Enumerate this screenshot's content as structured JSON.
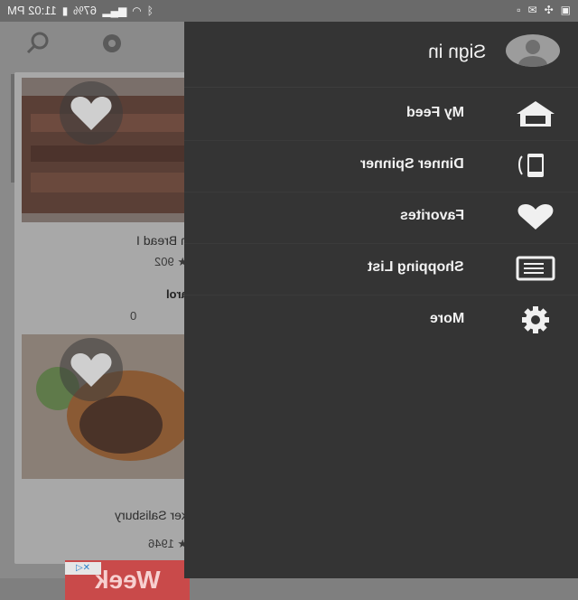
{
  "status_bar": {
    "time": "11:02 PM",
    "battery": "67%"
  },
  "drawer": {
    "sign_in": "Sign in",
    "items": [
      {
        "label": "My Feed",
        "icon": "home-icon"
      },
      {
        "label": "Dinner Spinner",
        "icon": "phone-spinner-icon"
      },
      {
        "label": "Favorites",
        "icon": "heart-icon"
      },
      {
        "label": "Shopping List",
        "icon": "list-icon"
      },
      {
        "label": "More",
        "icon": "gear-icon"
      }
    ]
  },
  "background_feed": {
    "cards": [
      {
        "title": "n Bread I",
        "rating": "902",
        "author": "arol",
        "count": "0"
      },
      {
        "title": "ker Salisbury",
        "rating": "1946"
      }
    ],
    "ad_text": "Week"
  },
  "colors": {
    "drawer_bg": "#343434",
    "text": "#f2f2f2",
    "dim_bg": "#8a8a8a"
  }
}
